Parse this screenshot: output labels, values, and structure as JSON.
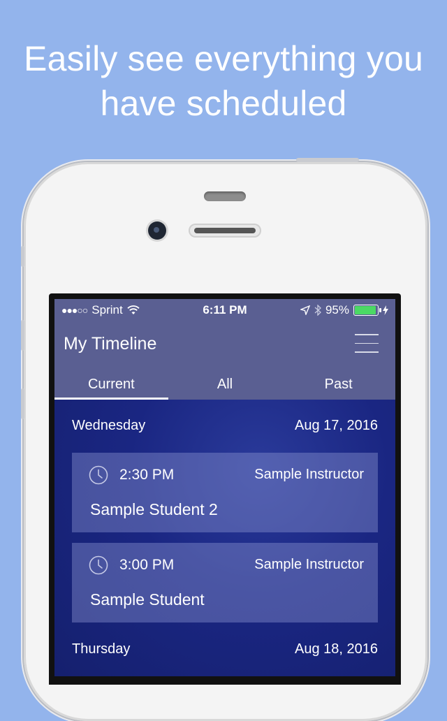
{
  "headline": {
    "line1": "Easily see everything you",
    "line2": "have scheduled"
  },
  "status_bar": {
    "signal": "●●●○○",
    "carrier": "Sprint",
    "time": "6:11 PM",
    "battery": "95%",
    "battery_color": "#4bd964"
  },
  "app": {
    "title": "My Timeline",
    "menu_icon": "hamburger-menu-icon",
    "tabs": [
      "Current",
      "All",
      "Past"
    ],
    "active_tab": "Current"
  },
  "days": [
    {
      "day": "Wednesday",
      "date": "Aug 17, 2016",
      "appointments": [
        {
          "time": "2:30 PM",
          "instructor": "Sample Instructor",
          "student": "Sample Student 2"
        },
        {
          "time": "3:00 PM",
          "instructor": "Sample Instructor",
          "student": "Sample Student"
        }
      ]
    },
    {
      "day": "Thursday",
      "date": "Aug 18, 2016",
      "appointments": []
    }
  ],
  "colors": {
    "background": "#93b4ec",
    "appbar": "#5a5f92",
    "screen": "#1a2682"
  }
}
